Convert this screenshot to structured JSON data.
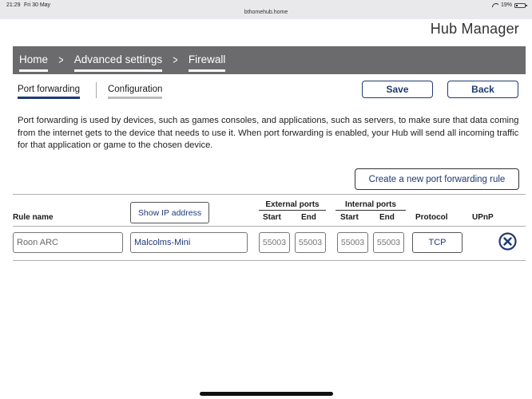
{
  "statusbar": {
    "time": "21:29",
    "date": "Fri 30 May",
    "url": "bthomehub.home",
    "battery": "19%",
    "battery_level": 0.19
  },
  "brand": "Hub Manager",
  "breadcrumb": {
    "home": "Home",
    "advanced": "Advanced settings",
    "current": "Firewall",
    "separator": ">"
  },
  "tabs": {
    "port_forwarding": "Port forwarding",
    "configuration": "Configuration"
  },
  "actions": {
    "save": "Save",
    "back": "Back",
    "create_rule": "Create a new port forwarding rule",
    "show_ip": "Show IP address"
  },
  "description": "Port forwarding is used by devices, such as games consoles, and applications, such as servers, to make sure that data coming from the internet gets to the device that needs to use it. When port forwarding is enabled, your Hub will send all incoming traffic for that application or game to the chosen device.",
  "table": {
    "headers": {
      "rule_name": "Rule name",
      "external_ports": "External ports",
      "internal_ports": "Internal ports",
      "start": "Start",
      "end": "End",
      "protocol": "Protocol",
      "upnp": "UPnP"
    },
    "rows": [
      {
        "rule_name": "Roon ARC",
        "device": "Malcolms-Mini",
        "external_start": "55003",
        "external_end": "55003",
        "internal_start": "55003",
        "internal_end": "55003",
        "protocol": "TCP"
      }
    ]
  },
  "colors": {
    "accent": "#1e3a73",
    "breadcrumb_bg": "#6b6b6d",
    "statusbar_bg": "#e9e9ec"
  }
}
